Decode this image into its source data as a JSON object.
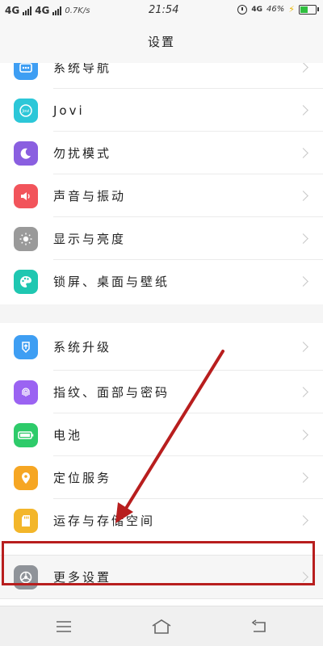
{
  "status_bar": {
    "net1": "4G",
    "net2": "4G",
    "speed": "0.7K/s",
    "time": "21:54",
    "net3": "4G",
    "battery_pct": "46%",
    "battery_level": 0.46
  },
  "header": {
    "title": "设置"
  },
  "group1": {
    "items": [
      {
        "label": "系统导航",
        "icon": "navigation-icon",
        "color": "#3e9ef3"
      },
      {
        "label": "Jovi",
        "icon": "jovi-icon",
        "color": "#2cc7d8"
      },
      {
        "label": "勿扰模式",
        "icon": "moon-icon",
        "color": "#8a5fe0"
      },
      {
        "label": "声音与振动",
        "icon": "speaker-icon",
        "color": "#f2545b"
      },
      {
        "label": "显示与亮度",
        "icon": "sun-icon",
        "color": "#9a9a9a"
      },
      {
        "label": "锁屏、桌面与壁纸",
        "icon": "palette-icon",
        "color": "#1fc7b1"
      }
    ]
  },
  "group2": {
    "items": [
      {
        "label": "系统升级",
        "icon": "upgrade-icon",
        "color": "#3e9ef3"
      },
      {
        "label": "指纹、面部与密码",
        "icon": "fingerprint-icon",
        "color": "#9b63f2"
      },
      {
        "label": "电池",
        "icon": "battery-icon",
        "color": "#2ecb6a"
      },
      {
        "label": "定位服务",
        "icon": "location-pin-icon",
        "color": "#f6a623"
      },
      {
        "label": "运存与存储空间",
        "icon": "sd-card-icon",
        "color": "#f3b62a"
      },
      {
        "label": "更多设置",
        "icon": "gear-icon",
        "color": "#8f9399"
      }
    ]
  },
  "annotation_color": "#b81e1e"
}
